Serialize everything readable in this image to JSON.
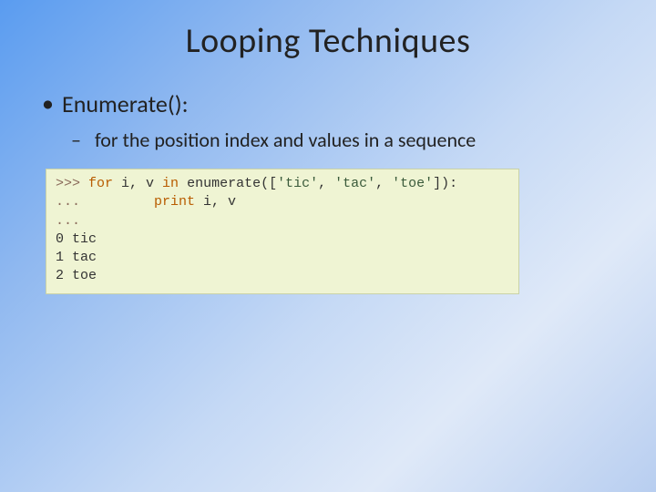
{
  "title": "Looping Techniques",
  "bullet1": "Enumerate():",
  "bullet2": "for the position index and values in a sequence",
  "code": {
    "line1_prompt": ">>> ",
    "line1_kw1": "for",
    "line1_mid": " i, v ",
    "line1_kw2": "in",
    "line1_call": " enumerate([",
    "line1_s1": "'tic'",
    "line1_c1": ", ",
    "line1_s2": "'tac'",
    "line1_c2": ", ",
    "line1_s3": "'toe'",
    "line1_end": "]):",
    "line2_prompt": "... ",
    "line2_indent": "        ",
    "line2_kw": "print",
    "line2_args": " i, v",
    "line3": "...",
    "out1": "0 tic",
    "out2": "1 tac",
    "out3": "2 toe"
  }
}
